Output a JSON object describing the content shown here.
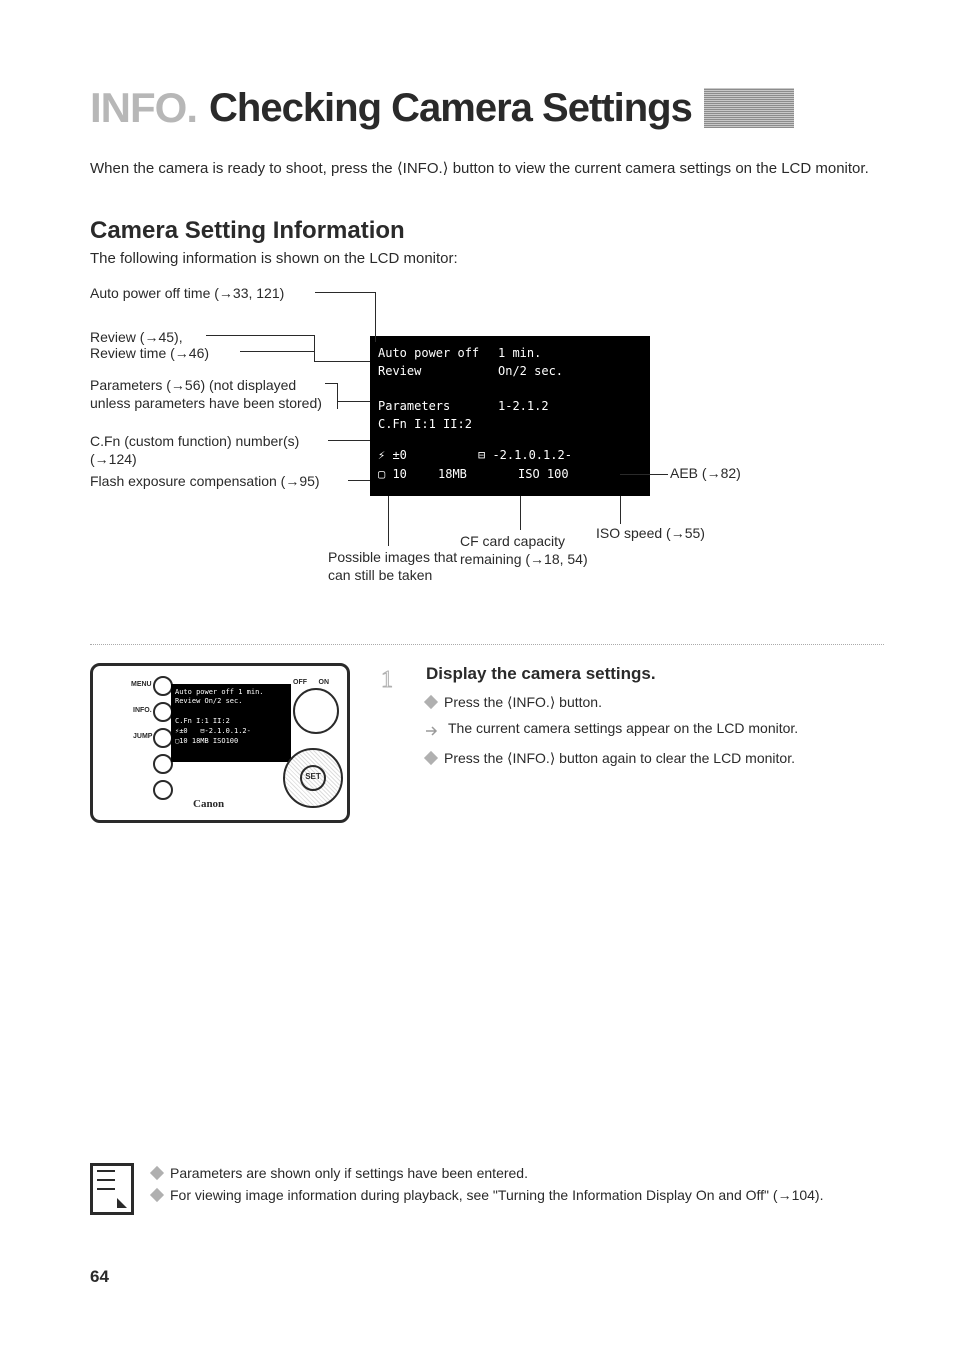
{
  "title": {
    "prefix": "INFO.",
    "main": "Checking Camera Settings"
  },
  "intro": "When the camera is ready to shoot, press the ⟨INFO.⟩ button to view the current camera settings on the LCD monitor.",
  "section": {
    "heading": "Camera Setting Information",
    "sub": "The following information is shown on the LCD monitor:"
  },
  "annotations": {
    "auto_power": "Auto power off time (→33, 121)",
    "review": "Review (→45),",
    "review_time": "Review time (→46)",
    "parameters": "Parameters (→56) (not displayed unless parameters have been stored)",
    "cfn": "C.Fn (custom function) number(s) (→124)",
    "flash_exp": "Flash exposure compensation (→95)",
    "aeb": "AEB (→82)",
    "iso": "ISO speed (→55)",
    "cf_cap": "CF card capacity remaining  (→18, 54)",
    "possible": "Possible images that can still be taken"
  },
  "lcd": {
    "row1a": "Auto power off",
    "row1b": "1 min.",
    "row2a": "Review",
    "row2b": "On/2 sec.",
    "row3a": "Parameters",
    "row3b": "1-2.1.2",
    "row4a": "C.Fn I:1 II:2",
    "row5a": "⚡ ±0",
    "row5b": "⊟ -2.1.0.1.2-",
    "row6a": "▢ 10",
    "row6b": "18MB",
    "row6c": "ISO 100"
  },
  "step": {
    "title": "Display the camera settings.",
    "b1": "Press the ⟨INFO.⟩ button.",
    "b2": "The current camera settings appear on the LCD monitor.",
    "b3": "Press the ⟨INFO.⟩ button again to clear the LCD monitor."
  },
  "camera_back": {
    "menu": "MENU",
    "info": "INFO.",
    "jump": "JUMP",
    "brand": "Canon",
    "set": "SET",
    "on": "ON",
    "off": "OFF"
  },
  "notes": {
    "n1": "Parameters are shown only if settings have been entered.",
    "n2": "For viewing image information during playback, see \"Turning the Information Display On and Off\" (→104)."
  },
  "page": "64"
}
